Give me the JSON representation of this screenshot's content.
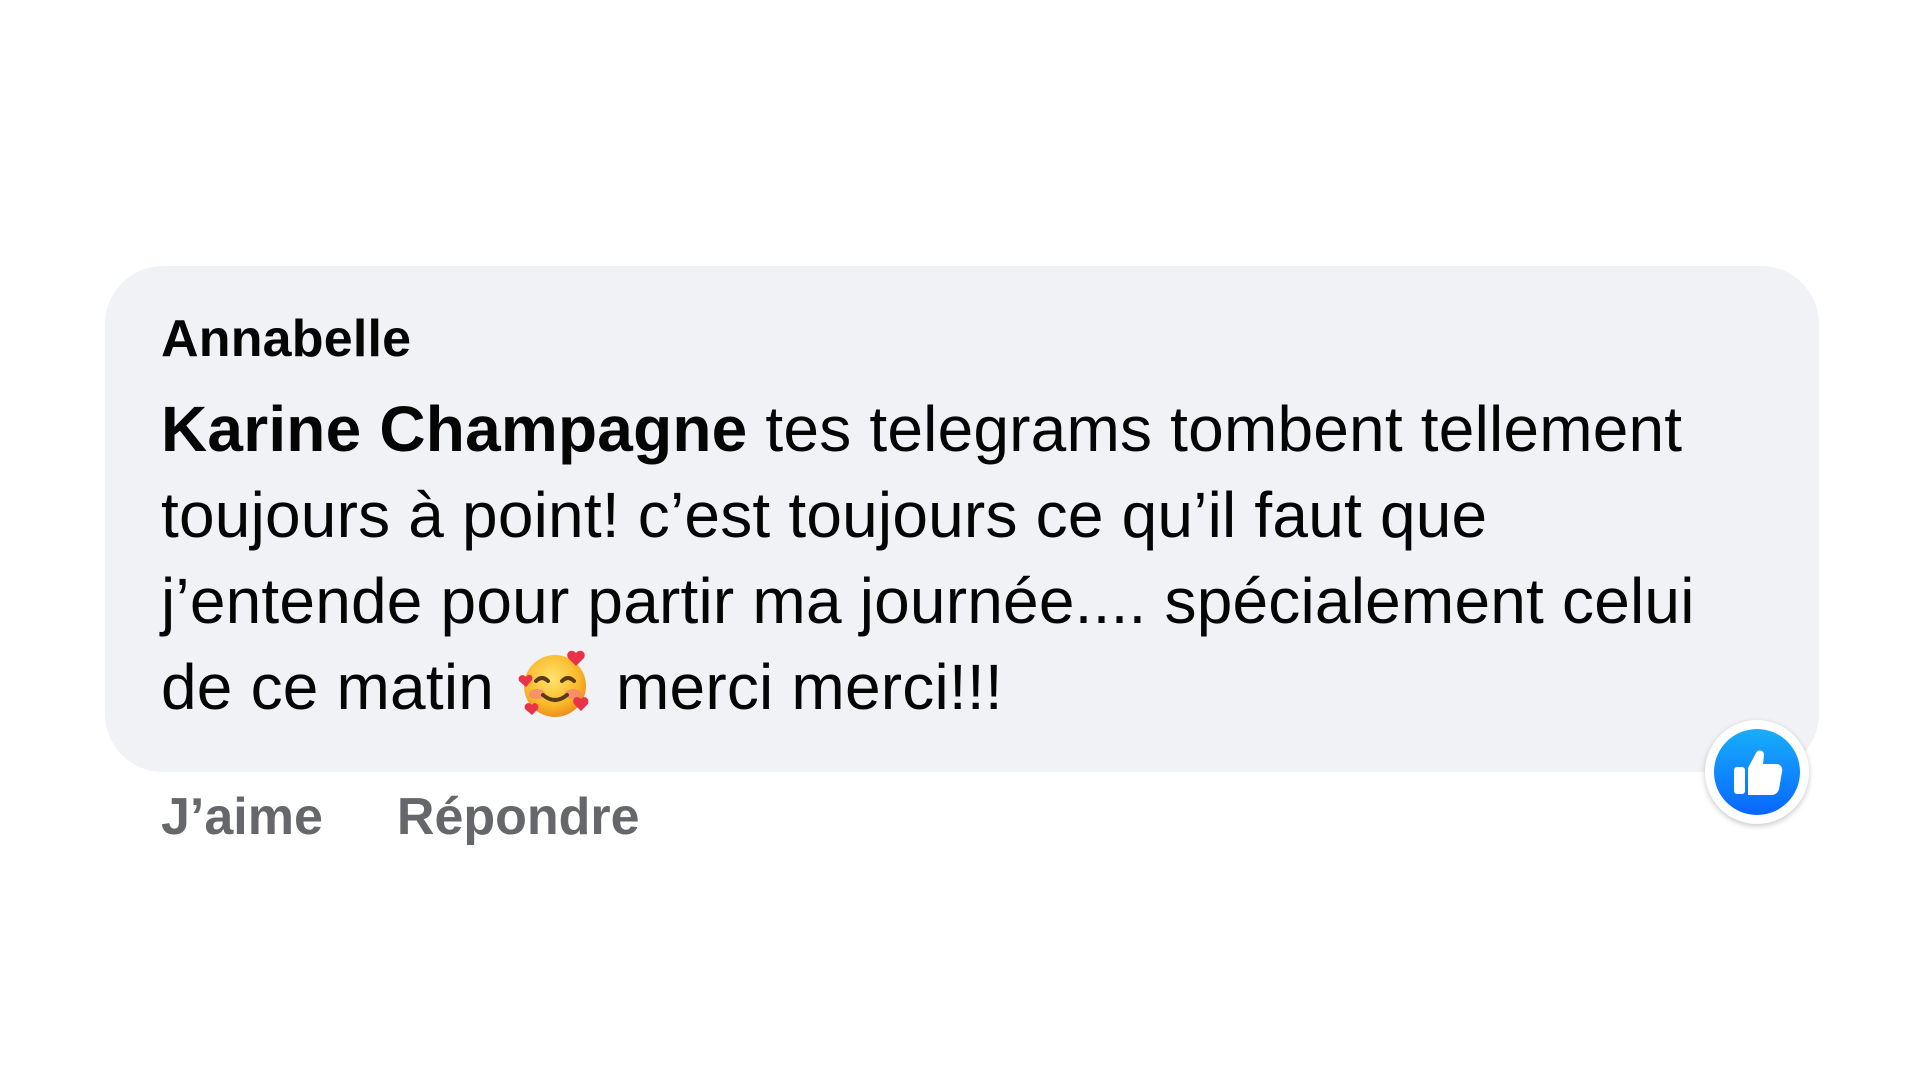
{
  "comment": {
    "author": "Annabelle",
    "mention": "Karine Champagne",
    "text_before_emoji": " tes telegrams tombent tellement toujours à point! c’est toujours ce qu’il faut que j’entende pour partir ma journée.... spécialement celui de ce matin ",
    "emoji": "smiling-face-with-hearts",
    "text_after_emoji": " merci merci!!!",
    "reaction": "like",
    "reaction_color": "#1877f2",
    "bubble_color": "#f0f2f5"
  },
  "actions": {
    "like_label": "J’aime",
    "reply_label": "Répondre"
  }
}
